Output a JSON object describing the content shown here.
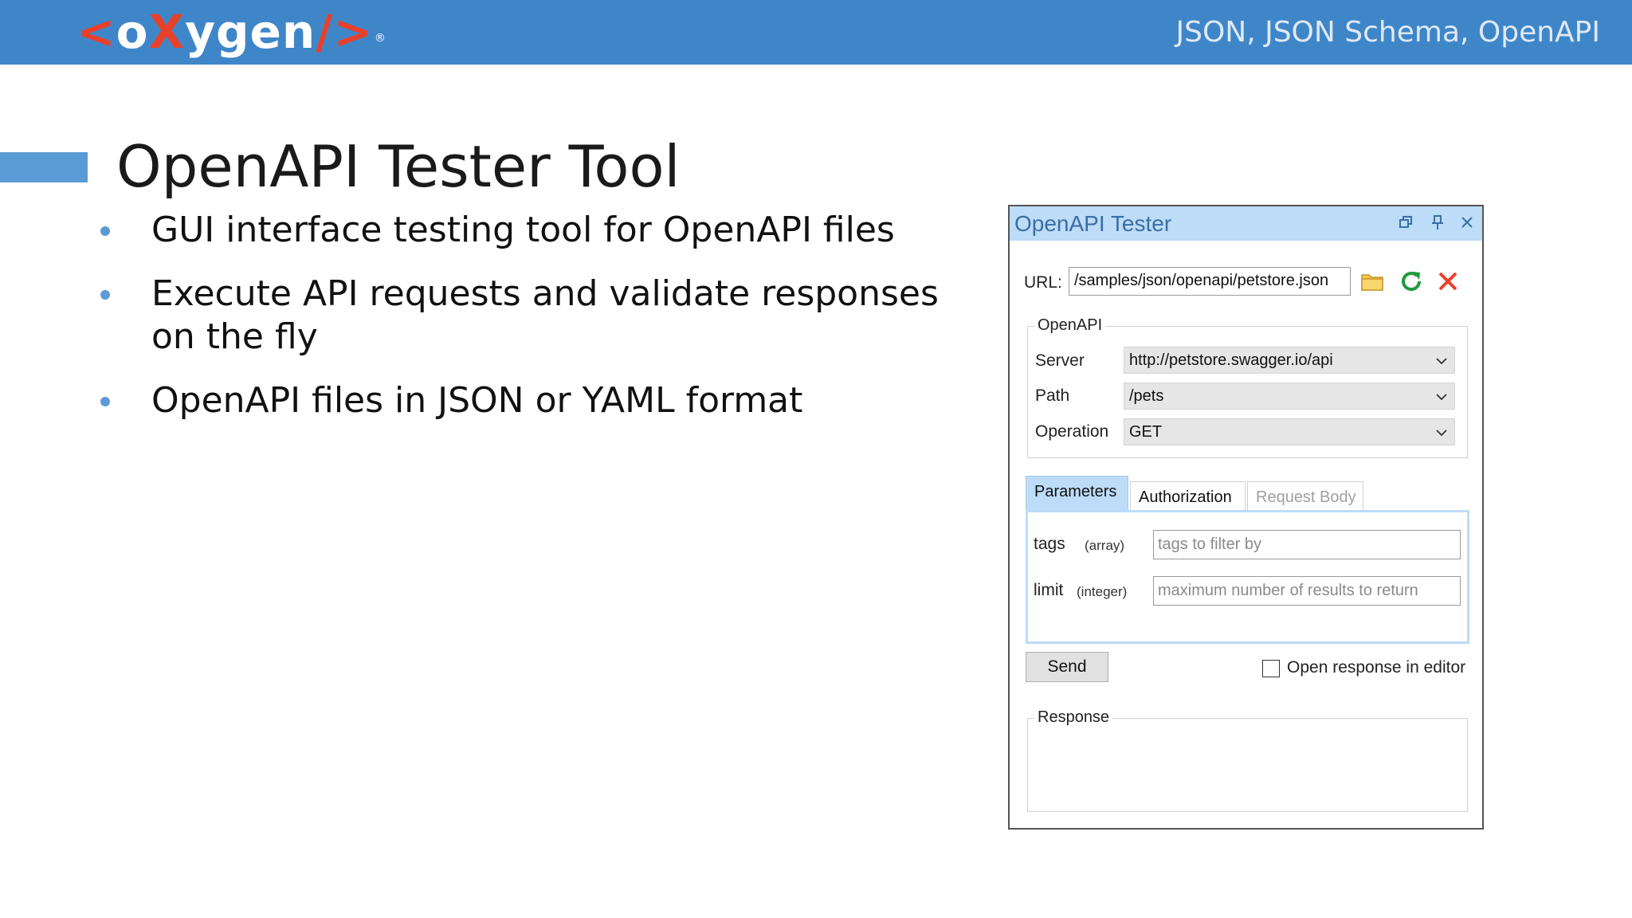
{
  "header": {
    "logo": {
      "open": "<",
      "o": "o",
      "x": "X",
      "rest": "ygen",
      "close": "/>",
      "registered": "®"
    },
    "topic": "JSON, JSON Schema, OpenAPI",
    "band_color": "#3f86c9"
  },
  "slide": {
    "title": "OpenAPI Tester Tool",
    "bullets": [
      "GUI interface testing tool for OpenAPI files",
      "Execute API requests and validate responses on the fly",
      "OpenAPI files in JSON or YAML format"
    ]
  },
  "tester": {
    "title": "OpenAPI Tester",
    "titlebar_icons": [
      "restore-icon",
      "pin-icon",
      "close-icon"
    ],
    "url_label": "URL:",
    "url_value": "/samples/json/openapi/petstore.json",
    "url_icons": [
      "folder-icon",
      "refresh-icon",
      "clear-icon"
    ],
    "openapi_group": {
      "legend": "OpenAPI",
      "server_label": "Server",
      "server_value": "http://petstore.swagger.io/api",
      "path_label": "Path",
      "path_value": "/pets",
      "operation_label": "Operation",
      "operation_value": "GET"
    },
    "tabs": [
      {
        "label": "Parameters",
        "state": "selected"
      },
      {
        "label": "Authorization",
        "state": "normal"
      },
      {
        "label": "Request Body",
        "state": "disabled"
      }
    ],
    "parameters": [
      {
        "name": "tags",
        "type": "(array)",
        "placeholder": "tags to filter by"
      },
      {
        "name": "limit",
        "type": "(integer)",
        "placeholder": "maximum number of results to return"
      }
    ],
    "send_label": "Send",
    "open_response_label": "Open response in editor",
    "open_response_checked": false,
    "response_legend": "Response"
  }
}
